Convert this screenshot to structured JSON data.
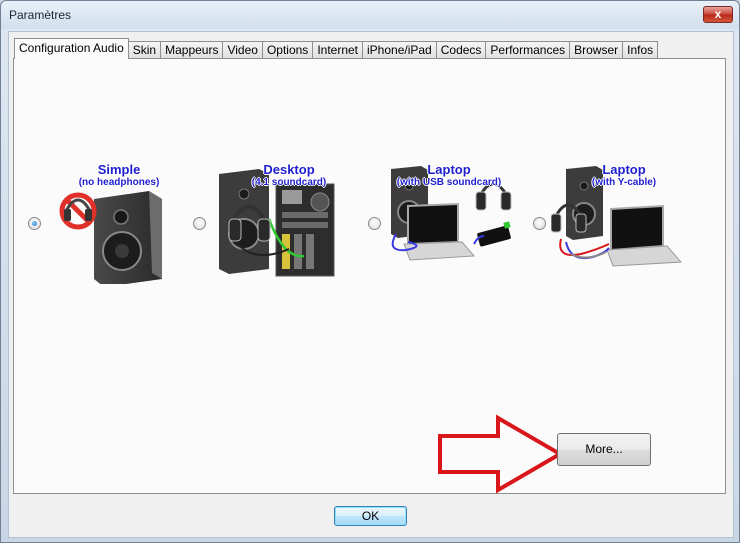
{
  "window": {
    "title": "Paramètres",
    "close_glyph": "x"
  },
  "tabs": [
    {
      "label": "Configuration Audio",
      "active": true
    },
    {
      "label": "Skin"
    },
    {
      "label": "Mappeurs"
    },
    {
      "label": "Video"
    },
    {
      "label": "Options"
    },
    {
      "label": "Internet"
    },
    {
      "label": "iPhone/iPad"
    },
    {
      "label": "Codecs"
    },
    {
      "label": "Performances"
    },
    {
      "label": "Browser"
    },
    {
      "label": "Infos"
    }
  ],
  "options": [
    {
      "title": "Simple",
      "subtitle": "(no headphones)",
      "checked": true,
      "icon": "speaker-no-headphones-image"
    },
    {
      "title": "Desktop",
      "subtitle": "(4.1 soundcard)",
      "checked": false,
      "icon": "desktop-tower-headphones-image"
    },
    {
      "title": "Laptop",
      "subtitle": "(with USB soundcard)",
      "checked": false,
      "icon": "laptop-usb-soundcard-image"
    },
    {
      "title": "Laptop",
      "subtitle": "(with Y-cable)",
      "checked": false,
      "icon": "laptop-y-cable-image"
    }
  ],
  "buttons": {
    "more": "More...",
    "ok": "OK"
  },
  "colors": {
    "option_title": "#1e1ecf",
    "arrow": "#d9161a",
    "prohibit": "#e0302a"
  }
}
